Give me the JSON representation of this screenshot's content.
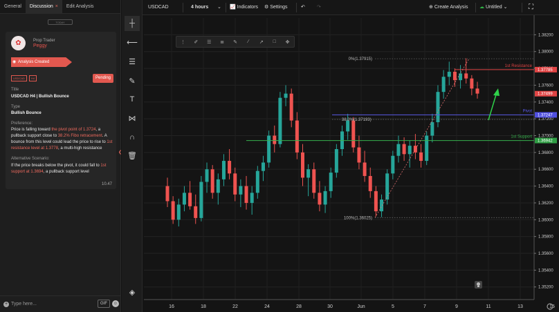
{
  "left_panel": {
    "tabs": [
      {
        "label": "General"
      },
      {
        "label": "Discussion",
        "close": "×"
      },
      {
        "label": "Edit Analysis"
      }
    ],
    "today_label": "TODAY",
    "message": {
      "author_role": "Prop Trader",
      "author_name": "Peggy",
      "banner": "Analysis Created",
      "badges": [
        "USDCAD",
        "H4"
      ],
      "status": "Pending",
      "title_label": "Title",
      "title_value": "USDCAD H4 | Bullish Bounce",
      "type_label": "Type",
      "type_value": "Bullish Bounce",
      "preference_label": "Preference:",
      "preference_parts": [
        "Price is falling toward ",
        "the pivot point of 1.3724",
        ", a pullback support close to ",
        "38.2% Fibo retracement",
        ". A bounce from this level could lead the price to rise to ",
        "1st resistance level at 1.3778",
        ", a multi-high resistance"
      ],
      "alt_label": "Alternative Scenario:",
      "alt_parts": [
        "If the price breaks below the pivot, it could fall  to ",
        "1st support at 1.3694",
        ", a pullback support level"
      ],
      "time": "10.47"
    },
    "input_placeholder": "Type here...",
    "gif_label": "GIF",
    "icons": {
      "attach": "plus-icon",
      "emoji": "emoji-icon",
      "collapse": "chevron-left-icon"
    }
  },
  "topbar": {
    "symbol": "USDCAD",
    "timeframe": "4 hours",
    "indicators": "Indicators",
    "settings": "Settings",
    "create": "Create Analysis",
    "untitled": "Untitled"
  },
  "chart_data": {
    "type": "candlestick",
    "x_ticks": [
      "16",
      "18",
      "22",
      "24",
      "28",
      "30",
      "Jun",
      "5",
      "7",
      "9",
      "11",
      "13",
      "15"
    ],
    "y_ticks": [
      "1.38200",
      "1.38000",
      "1.37800",
      "1.37600",
      "1.37400",
      "1.37200",
      "1.37000",
      "1.36800",
      "1.36600",
      "1.36400",
      "1.36200",
      "1.36000",
      "1.35800",
      "1.35600",
      "1.35400",
      "1.35200"
    ],
    "ylim": [
      1.3505,
      1.384
    ],
    "grid": true,
    "price_tags": [
      {
        "value": 1.37785,
        "text": "1.37785",
        "color": "#e04444"
      },
      {
        "value": 1.37499,
        "text": "1.37499",
        "color": "#e04444"
      },
      {
        "value": 1.37247,
        "text": "1.37247",
        "color": "#5050e0"
      },
      {
        "value": 1.36942,
        "text": "1.36942",
        "color": "#2f9e44"
      }
    ],
    "levels": [
      {
        "name": "1st Resistance",
        "value": 1.37785,
        "color": "#e04444"
      },
      {
        "name": "Pivot",
        "value": 1.37247,
        "color": "#5a5ae8"
      },
      {
        "name": "1st Support",
        "value": 1.36942,
        "color": "#37b24d"
      }
    ],
    "fib": {
      "high": 1.37915,
      "low": 1.36025,
      "labels": [
        "0%(1.37915)",
        "38.2%(1.37193)",
        "100%(1.36025)"
      ],
      "values": [
        1.37915,
        1.37193,
        1.36025
      ]
    },
    "candles": [
      [
        1.364,
        1.365,
        1.3615,
        1.3622
      ],
      [
        1.3622,
        1.3628,
        1.3595,
        1.36
      ],
      [
        1.36,
        1.3625,
        1.3592,
        1.3618
      ],
      [
        1.3618,
        1.364,
        1.361,
        1.3632
      ],
      [
        1.3632,
        1.3646,
        1.3612,
        1.3616
      ],
      [
        1.3616,
        1.363,
        1.3595,
        1.3602
      ],
      [
        1.3602,
        1.3652,
        1.3598,
        1.3645
      ],
      [
        1.3645,
        1.3668,
        1.3632,
        1.366
      ],
      [
        1.366,
        1.3665,
        1.3625,
        1.3632
      ],
      [
        1.3632,
        1.3655,
        1.3618,
        1.3648
      ],
      [
        1.3648,
        1.3678,
        1.364,
        1.367
      ],
      [
        1.367,
        1.3684,
        1.3648,
        1.3655
      ],
      [
        1.3655,
        1.3662,
        1.3622,
        1.363
      ],
      [
        1.363,
        1.3648,
        1.3615,
        1.364
      ],
      [
        1.364,
        1.3652,
        1.3612,
        1.362
      ],
      [
        1.362,
        1.364,
        1.3606,
        1.3632
      ],
      [
        1.3632,
        1.3664,
        1.3625,
        1.3658
      ],
      [
        1.3658,
        1.3676,
        1.3646,
        1.3668
      ],
      [
        1.3668,
        1.3706,
        1.3662,
        1.37
      ],
      [
        1.37,
        1.3712,
        1.368,
        1.369
      ],
      [
        1.369,
        1.3752,
        1.3686,
        1.3745
      ],
      [
        1.3745,
        1.376,
        1.3735,
        1.375
      ],
      [
        1.375,
        1.3756,
        1.371,
        1.3718
      ],
      [
        1.3718,
        1.3728,
        1.3672,
        1.368
      ],
      [
        1.368,
        1.369,
        1.364,
        1.365
      ],
      [
        1.365,
        1.3666,
        1.3628,
        1.366
      ],
      [
        1.366,
        1.3668,
        1.3625,
        1.3632
      ],
      [
        1.3632,
        1.3646,
        1.361,
        1.3618
      ],
      [
        1.3618,
        1.364,
        1.3608,
        1.3634
      ],
      [
        1.3634,
        1.3662,
        1.3626,
        1.3656
      ],
      [
        1.3656,
        1.369,
        1.365,
        1.3684
      ],
      [
        1.3684,
        1.3712,
        1.3676,
        1.3705
      ],
      [
        1.3705,
        1.3726,
        1.3695,
        1.3718
      ],
      [
        1.3718,
        1.3722,
        1.368,
        1.3686
      ],
      [
        1.3686,
        1.37,
        1.366,
        1.3668
      ],
      [
        1.3668,
        1.3682,
        1.3645,
        1.3652
      ],
      [
        1.3652,
        1.3662,
        1.3626,
        1.3634
      ],
      [
        1.3634,
        1.364,
        1.3604,
        1.361
      ],
      [
        1.361,
        1.363,
        1.3603,
        1.3624
      ],
      [
        1.3624,
        1.366,
        1.3618,
        1.3655
      ],
      [
        1.3655,
        1.3682,
        1.3648,
        1.3676
      ],
      [
        1.3676,
        1.37,
        1.3668,
        1.369
      ],
      [
        1.369,
        1.3698,
        1.367,
        1.3678
      ],
      [
        1.3678,
        1.3694,
        1.3662,
        1.3688
      ],
      [
        1.3688,
        1.3702,
        1.3672,
        1.368
      ],
      [
        1.368,
        1.369,
        1.3662,
        1.367
      ],
      [
        1.367,
        1.3705,
        1.3665,
        1.37
      ],
      [
        1.37,
        1.3726,
        1.3692,
        1.3716
      ],
      [
        1.3716,
        1.376,
        1.371,
        1.3752
      ],
      [
        1.3752,
        1.3778,
        1.3744,
        1.377
      ],
      [
        1.377,
        1.3788,
        1.376,
        1.3776
      ],
      [
        1.3776,
        1.378,
        1.3758,
        1.3766
      ],
      [
        1.3766,
        1.3784,
        1.3756,
        1.3774
      ],
      [
        1.3774,
        1.3792,
        1.3762,
        1.3768
      ],
      [
        1.3768,
        1.3772,
        1.3748,
        1.3756
      ],
      [
        1.3756,
        1.3764,
        1.3744,
        1.375
      ]
    ]
  }
}
